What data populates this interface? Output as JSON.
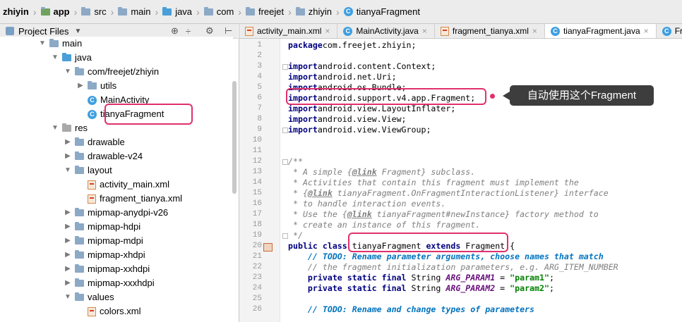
{
  "breadcrumb": [
    "zhiyin",
    "app",
    "src",
    "main",
    "java",
    "com",
    "freejet",
    "zhiyin",
    "tianyaFragment"
  ],
  "project_panel": {
    "title": "Project Files"
  },
  "tree": [
    {
      "label": "main",
      "indent": 0,
      "kind": "folder",
      "expand": "open"
    },
    {
      "label": "java",
      "indent": 1,
      "kind": "folder-blue",
      "expand": "open"
    },
    {
      "label": "com/freejet/zhiyin",
      "indent": 2,
      "kind": "folder",
      "expand": "open"
    },
    {
      "label": "utils",
      "indent": 3,
      "kind": "folder",
      "expand": "closed"
    },
    {
      "label": "MainActivity",
      "indent": 3,
      "kind": "class",
      "expand": "none"
    },
    {
      "label": "tianyaFragment",
      "indent": 3,
      "kind": "class",
      "expand": "none"
    },
    {
      "label": "res",
      "indent": 1,
      "kind": "folder-res",
      "expand": "open"
    },
    {
      "label": "drawable",
      "indent": 2,
      "kind": "folder",
      "expand": "closed"
    },
    {
      "label": "drawable-v24",
      "indent": 2,
      "kind": "folder",
      "expand": "closed"
    },
    {
      "label": "layout",
      "indent": 2,
      "kind": "folder",
      "expand": "open"
    },
    {
      "label": "activity_main.xml",
      "indent": 3,
      "kind": "xml",
      "expand": "none"
    },
    {
      "label": "fragment_tianya.xml",
      "indent": 3,
      "kind": "xml",
      "expand": "none"
    },
    {
      "label": "mipmap-anydpi-v26",
      "indent": 2,
      "kind": "folder",
      "expand": "closed"
    },
    {
      "label": "mipmap-hdpi",
      "indent": 2,
      "kind": "folder",
      "expand": "closed"
    },
    {
      "label": "mipmap-mdpi",
      "indent": 2,
      "kind": "folder",
      "expand": "closed"
    },
    {
      "label": "mipmap-xhdpi",
      "indent": 2,
      "kind": "folder",
      "expand": "closed"
    },
    {
      "label": "mipmap-xxhdpi",
      "indent": 2,
      "kind": "folder",
      "expand": "closed"
    },
    {
      "label": "mipmap-xxxhdpi",
      "indent": 2,
      "kind": "folder",
      "expand": "closed"
    },
    {
      "label": "values",
      "indent": 2,
      "kind": "folder",
      "expand": "open"
    },
    {
      "label": "colors.xml",
      "indent": 3,
      "kind": "xml",
      "expand": "none"
    }
  ],
  "tabs": [
    {
      "label": "activity_main.xml",
      "icon": "xml",
      "active": false
    },
    {
      "label": "MainActivity.java",
      "icon": "class",
      "active": false
    },
    {
      "label": "fragment_tianya.xml",
      "icon": "xml",
      "active": false
    },
    {
      "label": "tianyaFragment.java",
      "icon": "class",
      "active": true
    },
    {
      "label": "Fra",
      "icon": "class",
      "active": false
    }
  ],
  "code_lines": [
    {
      "n": "1",
      "tokens": [
        [
          "kw",
          "package"
        ],
        [
          "",
          "com.freejet.zhiyin;"
        ]
      ]
    },
    {
      "n": "2",
      "tokens": []
    },
    {
      "n": "3",
      "tokens": [
        [
          "kw",
          "import"
        ],
        [
          "",
          "android.content.Context;"
        ]
      ]
    },
    {
      "n": "4",
      "tokens": [
        [
          "kw",
          "import"
        ],
        [
          "",
          "android.net.Uri;"
        ]
      ]
    },
    {
      "n": "5",
      "tokens": [
        [
          "kw",
          "import"
        ],
        [
          "",
          "android.os.Bundle;"
        ]
      ]
    },
    {
      "n": "6",
      "tokens": [
        [
          "kw",
          "import"
        ],
        [
          "",
          "android.support.v4.app.Fragment;"
        ]
      ]
    },
    {
      "n": "7",
      "tokens": [
        [
          "kw",
          "import"
        ],
        [
          "",
          "android.view.LayoutInflater;"
        ]
      ]
    },
    {
      "n": "8",
      "tokens": [
        [
          "kw",
          "import"
        ],
        [
          "",
          "android.view.View;"
        ]
      ]
    },
    {
      "n": "9",
      "tokens": [
        [
          "kw",
          "import"
        ],
        [
          "",
          "android.view.ViewGroup;"
        ]
      ]
    },
    {
      "n": "10",
      "tokens": []
    },
    {
      "n": "11",
      "tokens": []
    },
    {
      "n": "12",
      "tokens": [
        [
          "cm",
          "/**"
        ]
      ]
    },
    {
      "n": "13",
      "tokens": [
        [
          "cm",
          " * A simple {"
        ],
        [
          "cm-b",
          "@link"
        ],
        [
          "cm",
          " Fragment} subclass."
        ]
      ]
    },
    {
      "n": "14",
      "tokens": [
        [
          "cm",
          " * Activities that contain this fragment must implement the"
        ]
      ]
    },
    {
      "n": "15",
      "tokens": [
        [
          "cm",
          " * {"
        ],
        [
          "cm-b",
          "@link"
        ],
        [
          "cm",
          " tianyaFragment.OnFragmentInteractionListener} interface"
        ]
      ]
    },
    {
      "n": "16",
      "tokens": [
        [
          "cm",
          " * to handle interaction events."
        ]
      ]
    },
    {
      "n": "17",
      "tokens": [
        [
          "cm",
          " * Use the {"
        ],
        [
          "cm-b",
          "@link"
        ],
        [
          "cm",
          " tianyaFragment#newInstance} factory method to"
        ]
      ]
    },
    {
      "n": "18",
      "tokens": [
        [
          "cm",
          " * create an instance of this fragment."
        ]
      ]
    },
    {
      "n": "19",
      "tokens": [
        [
          "cm",
          " */"
        ]
      ]
    },
    {
      "n": "20",
      "tokens": [
        [
          "kw",
          "public class"
        ],
        [
          "",
          " tianyaFragment "
        ],
        [
          "kw",
          "extends"
        ],
        [
          "",
          " Fragment {"
        ]
      ]
    },
    {
      "n": "21",
      "tokens": [
        [
          "",
          "    "
        ],
        [
          "todo",
          "// TODO: Rename parameter arguments, choose names that match"
        ]
      ]
    },
    {
      "n": "22",
      "tokens": [
        [
          "",
          "    "
        ],
        [
          "cm",
          "// the fragment initialization parameters, e.g. ARG_ITEM_NUMBER"
        ]
      ]
    },
    {
      "n": "23",
      "tokens": [
        [
          "",
          "    "
        ],
        [
          "kw",
          "private static final"
        ],
        [
          "",
          " String "
        ],
        [
          "fld",
          "ARG_PARAM1"
        ],
        [
          "",
          " = "
        ],
        [
          "str",
          "\"param1\""
        ],
        [
          "",
          ";"
        ]
      ]
    },
    {
      "n": "24",
      "tokens": [
        [
          "",
          "    "
        ],
        [
          "kw",
          "private static final"
        ],
        [
          "",
          " String "
        ],
        [
          "fld",
          "ARG_PARAM2"
        ],
        [
          "",
          " = "
        ],
        [
          "str",
          "\"param2\""
        ],
        [
          "",
          ";"
        ]
      ]
    },
    {
      "n": "25",
      "tokens": []
    },
    {
      "n": "26",
      "tokens": [
        [
          "",
          "    "
        ],
        [
          "todo",
          "// TODO: Rename and change types of parameters"
        ]
      ]
    }
  ],
  "annotation": {
    "callout_text": "自动使用这个Fragment"
  }
}
